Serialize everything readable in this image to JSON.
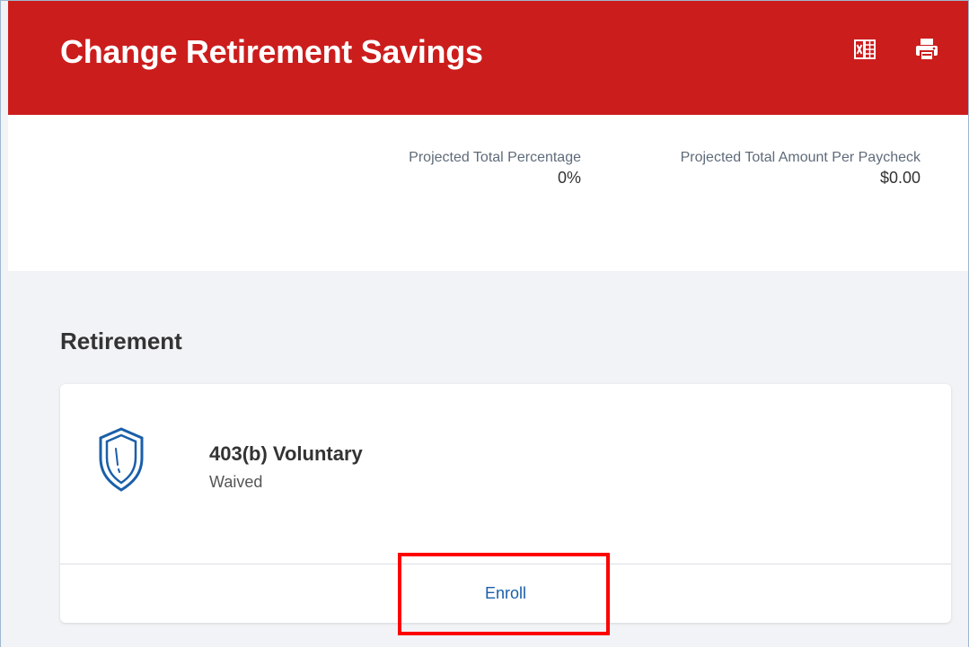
{
  "header": {
    "title": "Change Retirement Savings",
    "background_color": "#cc1d1d",
    "icons": [
      "excel-export-icon",
      "print-icon"
    ]
  },
  "summary": {
    "projected_percentage_label": "Projected Total Percentage",
    "projected_percentage_value": "0%",
    "projected_amount_label": "Projected Total Amount Per Paycheck",
    "projected_amount_value": "$0.00"
  },
  "section": {
    "title": "Retirement"
  },
  "plan_card": {
    "icon": "shield-icon",
    "name": "403(b) Voluntary",
    "status": "Waived",
    "action_label": "Enroll"
  },
  "colors": {
    "accent": "#1a5fa8",
    "highlight": "#ff0000"
  }
}
